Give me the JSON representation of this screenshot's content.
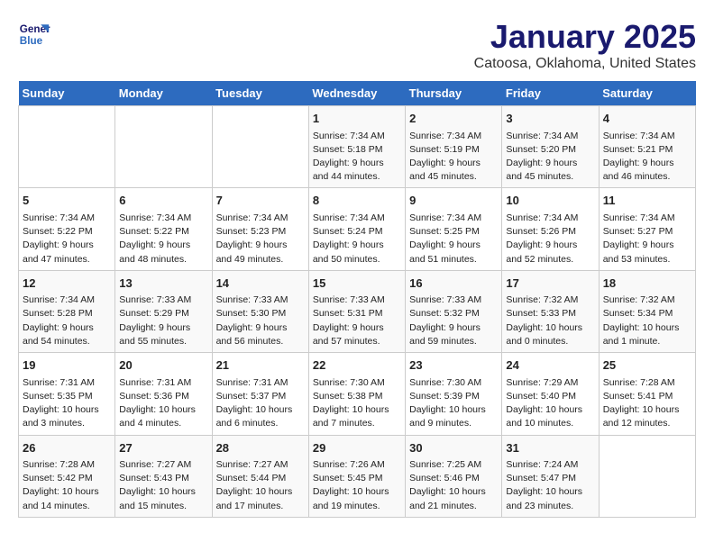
{
  "logo": {
    "line1": "General",
    "line2": "Blue"
  },
  "title": "January 2025",
  "subtitle": "Catoosa, Oklahoma, United States",
  "days_of_week": [
    "Sunday",
    "Monday",
    "Tuesday",
    "Wednesday",
    "Thursday",
    "Friday",
    "Saturday"
  ],
  "weeks": [
    [
      {
        "num": "",
        "sunrise": "",
        "sunset": "",
        "daylight": ""
      },
      {
        "num": "",
        "sunrise": "",
        "sunset": "",
        "daylight": ""
      },
      {
        "num": "",
        "sunrise": "",
        "sunset": "",
        "daylight": ""
      },
      {
        "num": "1",
        "sunrise": "Sunrise: 7:34 AM",
        "sunset": "Sunset: 5:18 PM",
        "daylight": "Daylight: 9 hours and 44 minutes."
      },
      {
        "num": "2",
        "sunrise": "Sunrise: 7:34 AM",
        "sunset": "Sunset: 5:19 PM",
        "daylight": "Daylight: 9 hours and 45 minutes."
      },
      {
        "num": "3",
        "sunrise": "Sunrise: 7:34 AM",
        "sunset": "Sunset: 5:20 PM",
        "daylight": "Daylight: 9 hours and 45 minutes."
      },
      {
        "num": "4",
        "sunrise": "Sunrise: 7:34 AM",
        "sunset": "Sunset: 5:21 PM",
        "daylight": "Daylight: 9 hours and 46 minutes."
      }
    ],
    [
      {
        "num": "5",
        "sunrise": "Sunrise: 7:34 AM",
        "sunset": "Sunset: 5:22 PM",
        "daylight": "Daylight: 9 hours and 47 minutes."
      },
      {
        "num": "6",
        "sunrise": "Sunrise: 7:34 AM",
        "sunset": "Sunset: 5:22 PM",
        "daylight": "Daylight: 9 hours and 48 minutes."
      },
      {
        "num": "7",
        "sunrise": "Sunrise: 7:34 AM",
        "sunset": "Sunset: 5:23 PM",
        "daylight": "Daylight: 9 hours and 49 minutes."
      },
      {
        "num": "8",
        "sunrise": "Sunrise: 7:34 AM",
        "sunset": "Sunset: 5:24 PM",
        "daylight": "Daylight: 9 hours and 50 minutes."
      },
      {
        "num": "9",
        "sunrise": "Sunrise: 7:34 AM",
        "sunset": "Sunset: 5:25 PM",
        "daylight": "Daylight: 9 hours and 51 minutes."
      },
      {
        "num": "10",
        "sunrise": "Sunrise: 7:34 AM",
        "sunset": "Sunset: 5:26 PM",
        "daylight": "Daylight: 9 hours and 52 minutes."
      },
      {
        "num": "11",
        "sunrise": "Sunrise: 7:34 AM",
        "sunset": "Sunset: 5:27 PM",
        "daylight": "Daylight: 9 hours and 53 minutes."
      }
    ],
    [
      {
        "num": "12",
        "sunrise": "Sunrise: 7:34 AM",
        "sunset": "Sunset: 5:28 PM",
        "daylight": "Daylight: 9 hours and 54 minutes."
      },
      {
        "num": "13",
        "sunrise": "Sunrise: 7:33 AM",
        "sunset": "Sunset: 5:29 PM",
        "daylight": "Daylight: 9 hours and 55 minutes."
      },
      {
        "num": "14",
        "sunrise": "Sunrise: 7:33 AM",
        "sunset": "Sunset: 5:30 PM",
        "daylight": "Daylight: 9 hours and 56 minutes."
      },
      {
        "num": "15",
        "sunrise": "Sunrise: 7:33 AM",
        "sunset": "Sunset: 5:31 PM",
        "daylight": "Daylight: 9 hours and 57 minutes."
      },
      {
        "num": "16",
        "sunrise": "Sunrise: 7:33 AM",
        "sunset": "Sunset: 5:32 PM",
        "daylight": "Daylight: 9 hours and 59 minutes."
      },
      {
        "num": "17",
        "sunrise": "Sunrise: 7:32 AM",
        "sunset": "Sunset: 5:33 PM",
        "daylight": "Daylight: 10 hours and 0 minutes."
      },
      {
        "num": "18",
        "sunrise": "Sunrise: 7:32 AM",
        "sunset": "Sunset: 5:34 PM",
        "daylight": "Daylight: 10 hours and 1 minute."
      }
    ],
    [
      {
        "num": "19",
        "sunrise": "Sunrise: 7:31 AM",
        "sunset": "Sunset: 5:35 PM",
        "daylight": "Daylight: 10 hours and 3 minutes."
      },
      {
        "num": "20",
        "sunrise": "Sunrise: 7:31 AM",
        "sunset": "Sunset: 5:36 PM",
        "daylight": "Daylight: 10 hours and 4 minutes."
      },
      {
        "num": "21",
        "sunrise": "Sunrise: 7:31 AM",
        "sunset": "Sunset: 5:37 PM",
        "daylight": "Daylight: 10 hours and 6 minutes."
      },
      {
        "num": "22",
        "sunrise": "Sunrise: 7:30 AM",
        "sunset": "Sunset: 5:38 PM",
        "daylight": "Daylight: 10 hours and 7 minutes."
      },
      {
        "num": "23",
        "sunrise": "Sunrise: 7:30 AM",
        "sunset": "Sunset: 5:39 PM",
        "daylight": "Daylight: 10 hours and 9 minutes."
      },
      {
        "num": "24",
        "sunrise": "Sunrise: 7:29 AM",
        "sunset": "Sunset: 5:40 PM",
        "daylight": "Daylight: 10 hours and 10 minutes."
      },
      {
        "num": "25",
        "sunrise": "Sunrise: 7:28 AM",
        "sunset": "Sunset: 5:41 PM",
        "daylight": "Daylight: 10 hours and 12 minutes."
      }
    ],
    [
      {
        "num": "26",
        "sunrise": "Sunrise: 7:28 AM",
        "sunset": "Sunset: 5:42 PM",
        "daylight": "Daylight: 10 hours and 14 minutes."
      },
      {
        "num": "27",
        "sunrise": "Sunrise: 7:27 AM",
        "sunset": "Sunset: 5:43 PM",
        "daylight": "Daylight: 10 hours and 15 minutes."
      },
      {
        "num": "28",
        "sunrise": "Sunrise: 7:27 AM",
        "sunset": "Sunset: 5:44 PM",
        "daylight": "Daylight: 10 hours and 17 minutes."
      },
      {
        "num": "29",
        "sunrise": "Sunrise: 7:26 AM",
        "sunset": "Sunset: 5:45 PM",
        "daylight": "Daylight: 10 hours and 19 minutes."
      },
      {
        "num": "30",
        "sunrise": "Sunrise: 7:25 AM",
        "sunset": "Sunset: 5:46 PM",
        "daylight": "Daylight: 10 hours and 21 minutes."
      },
      {
        "num": "31",
        "sunrise": "Sunrise: 7:24 AM",
        "sunset": "Sunset: 5:47 PM",
        "daylight": "Daylight: 10 hours and 23 minutes."
      },
      {
        "num": "",
        "sunrise": "",
        "sunset": "",
        "daylight": ""
      }
    ]
  ]
}
